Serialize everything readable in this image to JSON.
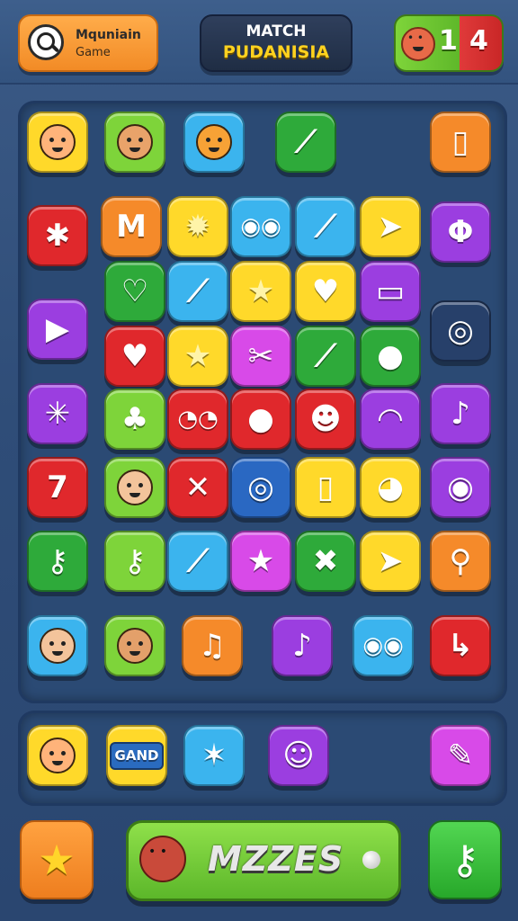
{
  "header": {
    "search_title": "Mquniain",
    "search_subtitle": "Game",
    "title_line1": "MATCH",
    "title_line2": "PUDANISIA",
    "score_left": "1",
    "score_right": "4"
  },
  "colors": {
    "yellow": "#ffd92a",
    "lime": "#7ed43a",
    "green": "#2eaa3a",
    "cyan": "#3bb4ee",
    "orange": "#f58a2a",
    "red": "#e0282c",
    "purple": "#9b3ee0",
    "magenta": "#d84ae8",
    "navy": "#27406a",
    "blue": "#2a68c2"
  },
  "tiles": [
    {
      "name": "girl-face-icon",
      "color": "yellow",
      "glyph": "",
      "face": "#ffb37a"
    },
    {
      "name": "cat-face-icon",
      "color": "lime",
      "glyph": "",
      "face": "#e9a36a"
    },
    {
      "name": "smiley-face-icon",
      "color": "cyan",
      "glyph": "",
      "face": "#f7a236"
    },
    {
      "name": "brush-icon",
      "color": "green",
      "glyph": "⟋"
    },
    {
      "name": "battery-icon",
      "color": "orange",
      "glyph": "▯"
    },
    {
      "name": "wrench-icon",
      "color": "red",
      "glyph": "✱"
    },
    {
      "name": "letter-m-icon",
      "color": "orange",
      "glyph": "M"
    },
    {
      "name": "sun-burst-icon",
      "color": "yellow",
      "glyph": "✹"
    },
    {
      "name": "goggle-monster-icon",
      "color": "cyan",
      "glyph": "◉◉"
    },
    {
      "name": "check-stick-icon",
      "color": "cyan",
      "glyph": "⟋"
    },
    {
      "name": "paper-plane-icon",
      "color": "yellow",
      "glyph": "➤"
    },
    {
      "name": "phi-icon",
      "color": "purple",
      "glyph": "Φ"
    },
    {
      "name": "heart-outline-icon",
      "color": "green",
      "glyph": "♡"
    },
    {
      "name": "check-stick-icon",
      "color": "cyan",
      "glyph": "⟋"
    },
    {
      "name": "star-icon",
      "color": "yellow",
      "glyph": "★"
    },
    {
      "name": "heart-tile-icon",
      "color": "yellow",
      "glyph": "♥"
    },
    {
      "name": "phone-icon",
      "color": "purple",
      "glyph": "▭"
    },
    {
      "name": "play-icon",
      "color": "purple",
      "glyph": "▶"
    },
    {
      "name": "shield-icon",
      "color": "red",
      "glyph": "♥"
    },
    {
      "name": "star-icon",
      "color": "yellow",
      "glyph": "★"
    },
    {
      "name": "scissors-icon",
      "color": "magenta",
      "glyph": "✂"
    },
    {
      "name": "paintbrush-icon",
      "color": "green",
      "glyph": "⟋"
    },
    {
      "name": "record-button-icon",
      "color": "green",
      "glyph": "●"
    },
    {
      "name": "ring-icon",
      "color": "navy",
      "glyph": "◎"
    },
    {
      "name": "sparkle-stick-icon",
      "color": "purple",
      "glyph": "✳"
    },
    {
      "name": "palm-tree-icon",
      "color": "lime",
      "glyph": "♣"
    },
    {
      "name": "ghost-eyes-icon",
      "color": "red",
      "glyph": "◔◔"
    },
    {
      "name": "apple-icon",
      "color": "red",
      "glyph": "●"
    },
    {
      "name": "skull-badge-icon",
      "color": "red",
      "glyph": "☻"
    },
    {
      "name": "ghost-icon",
      "color": "purple",
      "glyph": "◠"
    },
    {
      "name": "music-note-icon",
      "color": "purple",
      "glyph": "♪"
    },
    {
      "name": "number-seven-icon",
      "color": "red",
      "glyph": "7"
    },
    {
      "name": "woman-face-icon",
      "color": "lime",
      "glyph": "",
      "face": "#f3c49b"
    },
    {
      "name": "crossed-tools-icon",
      "color": "red",
      "glyph": "✕"
    },
    {
      "name": "ring-icon",
      "color": "blue",
      "glyph": "◎"
    },
    {
      "name": "battery-icon",
      "color": "yellow",
      "glyph": "▯"
    },
    {
      "name": "bird-monster-icon",
      "color": "yellow",
      "glyph": "◕"
    },
    {
      "name": "target-dot-icon",
      "color": "purple",
      "glyph": "◉"
    },
    {
      "name": "key-icon",
      "color": "green",
      "glyph": "⚷"
    },
    {
      "name": "key-icon",
      "color": "lime",
      "glyph": "⚷"
    },
    {
      "name": "check-stick-icon",
      "color": "cyan",
      "glyph": "⟋"
    },
    {
      "name": "star-icon",
      "color": "magenta",
      "glyph": "★"
    },
    {
      "name": "cross-x-icon",
      "color": "green",
      "glyph": "✖"
    },
    {
      "name": "paper-plane-icon",
      "color": "yellow",
      "glyph": "➤"
    },
    {
      "name": "pin-icon",
      "color": "orange",
      "glyph": "⚲"
    },
    {
      "name": "woman-face-icon",
      "color": "cyan",
      "glyph": "",
      "face": "#f3c49b"
    },
    {
      "name": "girl-face-icon",
      "color": "lime",
      "glyph": "",
      "face": "#e3a06a"
    },
    {
      "name": "chili-icon",
      "color": "orange",
      "glyph": "♫"
    },
    {
      "name": "music-note-icon",
      "color": "purple",
      "glyph": "♪"
    },
    {
      "name": "goggle-monster-icon",
      "color": "cyan",
      "glyph": "◉◉"
    },
    {
      "name": "sign-icon",
      "color": "red",
      "glyph": "↳"
    }
  ],
  "tray": [
    {
      "name": "girl-face-icon",
      "color": "yellow",
      "glyph": "",
      "face": "#ffb37a"
    },
    {
      "name": "game-screen-icon",
      "color": "yellow",
      "glyph": "GAND"
    },
    {
      "name": "star-creature-icon",
      "color": "cyan",
      "glyph": "✶"
    },
    {
      "name": "alien-face-icon",
      "color": "purple",
      "glyph": "☺"
    },
    {
      "name": "magic-brush-icon",
      "color": "magenta",
      "glyph": "✎"
    }
  ],
  "bottom": {
    "star_glyph": "★",
    "main_label": "MZZES",
    "key_glyph": "⚷"
  }
}
